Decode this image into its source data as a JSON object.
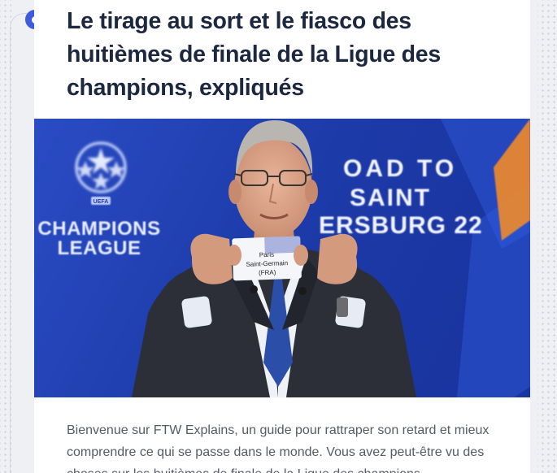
{
  "article": {
    "title": "Le tirage au sort et le fiasco des huitièmes de finale de la Ligue des champions, expliqués",
    "intro": "Bienvenue sur FTW Explains, un guide pour rattraper son retard et mieux comprendre ce qui se passe dans le monde. Vous avez peut-être vu des choses sur les huitièmes de finale de la Ligue des champions"
  },
  "hero_image": {
    "logo_text_line1": "CHAMPIONS",
    "logo_text_line2": "LEAGUE",
    "logo_badge": "UEFA",
    "banner_line1": "OAD TO",
    "banner_line2": "SAINT",
    "banner_line3": "ERSBURG 22",
    "card_line1": "Paris",
    "card_line2": "Saint-Germain",
    "card_line3": "(FRA)"
  },
  "colors": {
    "timeline_accent": "#3f5bd9",
    "title": "#1c2740",
    "banner_bg": "#1f3fb0",
    "banner_orange": "#f08a2a"
  }
}
